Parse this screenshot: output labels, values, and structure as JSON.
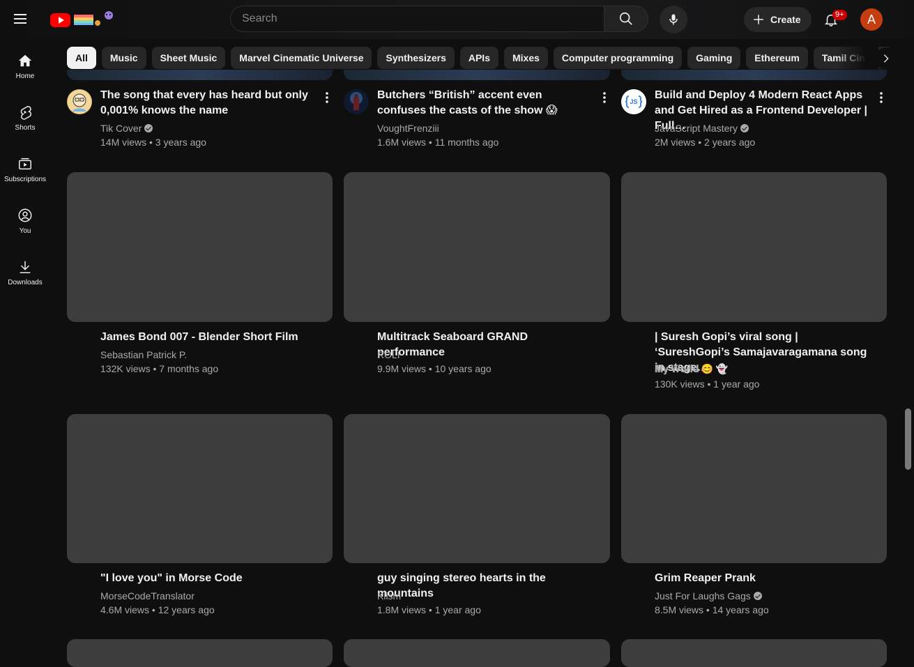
{
  "header": {
    "search_placeholder": "Search",
    "create_label": "Create",
    "notification_count": "9+",
    "avatar_letter": "A"
  },
  "chips": [
    "All",
    "Music",
    "Sheet Music",
    "Marvel Cinematic Universe",
    "Synthesizers",
    "APIs",
    "Mixes",
    "Computer programming",
    "Gaming",
    "Ethereum",
    "Tamil Cinema"
  ],
  "sidebar": {
    "items": [
      {
        "label": "Home",
        "icon": "home-icon"
      },
      {
        "label": "Shorts",
        "icon": "shorts-icon"
      },
      {
        "label": "Subscriptions",
        "icon": "subscriptions-icon"
      },
      {
        "label": "You",
        "icon": "you-icon"
      },
      {
        "label": "Downloads",
        "icon": "download-icon"
      }
    ]
  },
  "videos": {
    "row1": [
      {
        "title": "The song that every has heard but only 0,001% knows the name",
        "channel": "Tik Cover",
        "meta": "14M views • 3 years ago"
      },
      {
        "title": "Butchers “British” accent even confuses the casts of the show 😱",
        "channel": "VoughtFrenziii",
        "meta": "1.6M views • 11 months ago"
      },
      {
        "title": "Build and Deploy 4 Modern React Apps and Get Hired as a Frontend Developer | Full…",
        "channel": "JavaScript Mastery",
        "meta": "2M views • 2 years ago"
      }
    ],
    "row2": [
      {
        "title": "James Bond 007 - Blender Short Film",
        "channel": "Sebastian Patrick P.",
        "meta": "132K views • 7 months ago"
      },
      {
        "title": "Multitrack Seaboard GRAND performance",
        "channel": "ROLI",
        "meta": "9.9M views • 10 years ago"
      },
      {
        "title": "| Suresh Gopi’s viral song | ‘SureshGopi’s Samajavaragamana song in stage…",
        "channel": "𝐌𝐲 𝐖𝐨𝐫𝐥𝐝 😊 👻",
        "meta": "130K views • 1 year ago"
      }
    ],
    "row3": [
      {
        "title": "\"I love you\" in Morse Code",
        "channel": "MorseCodeTranslator",
        "meta": "4.6M views • 12 years ago"
      },
      {
        "title": "guy singing stereo hearts in the mountains",
        "channel": "Klism",
        "meta": "1.8M views • 1 year ago"
      },
      {
        "title": "Grim Reaper Prank",
        "channel": "Just For Laughs Gags",
        "meta": "8.5M views • 14 years ago"
      }
    ]
  },
  "colors": {
    "brand_red": "#ff0000",
    "background": "#0f0f0f",
    "chip": "#272727",
    "thumb_placeholder": "#3d3d3d"
  }
}
